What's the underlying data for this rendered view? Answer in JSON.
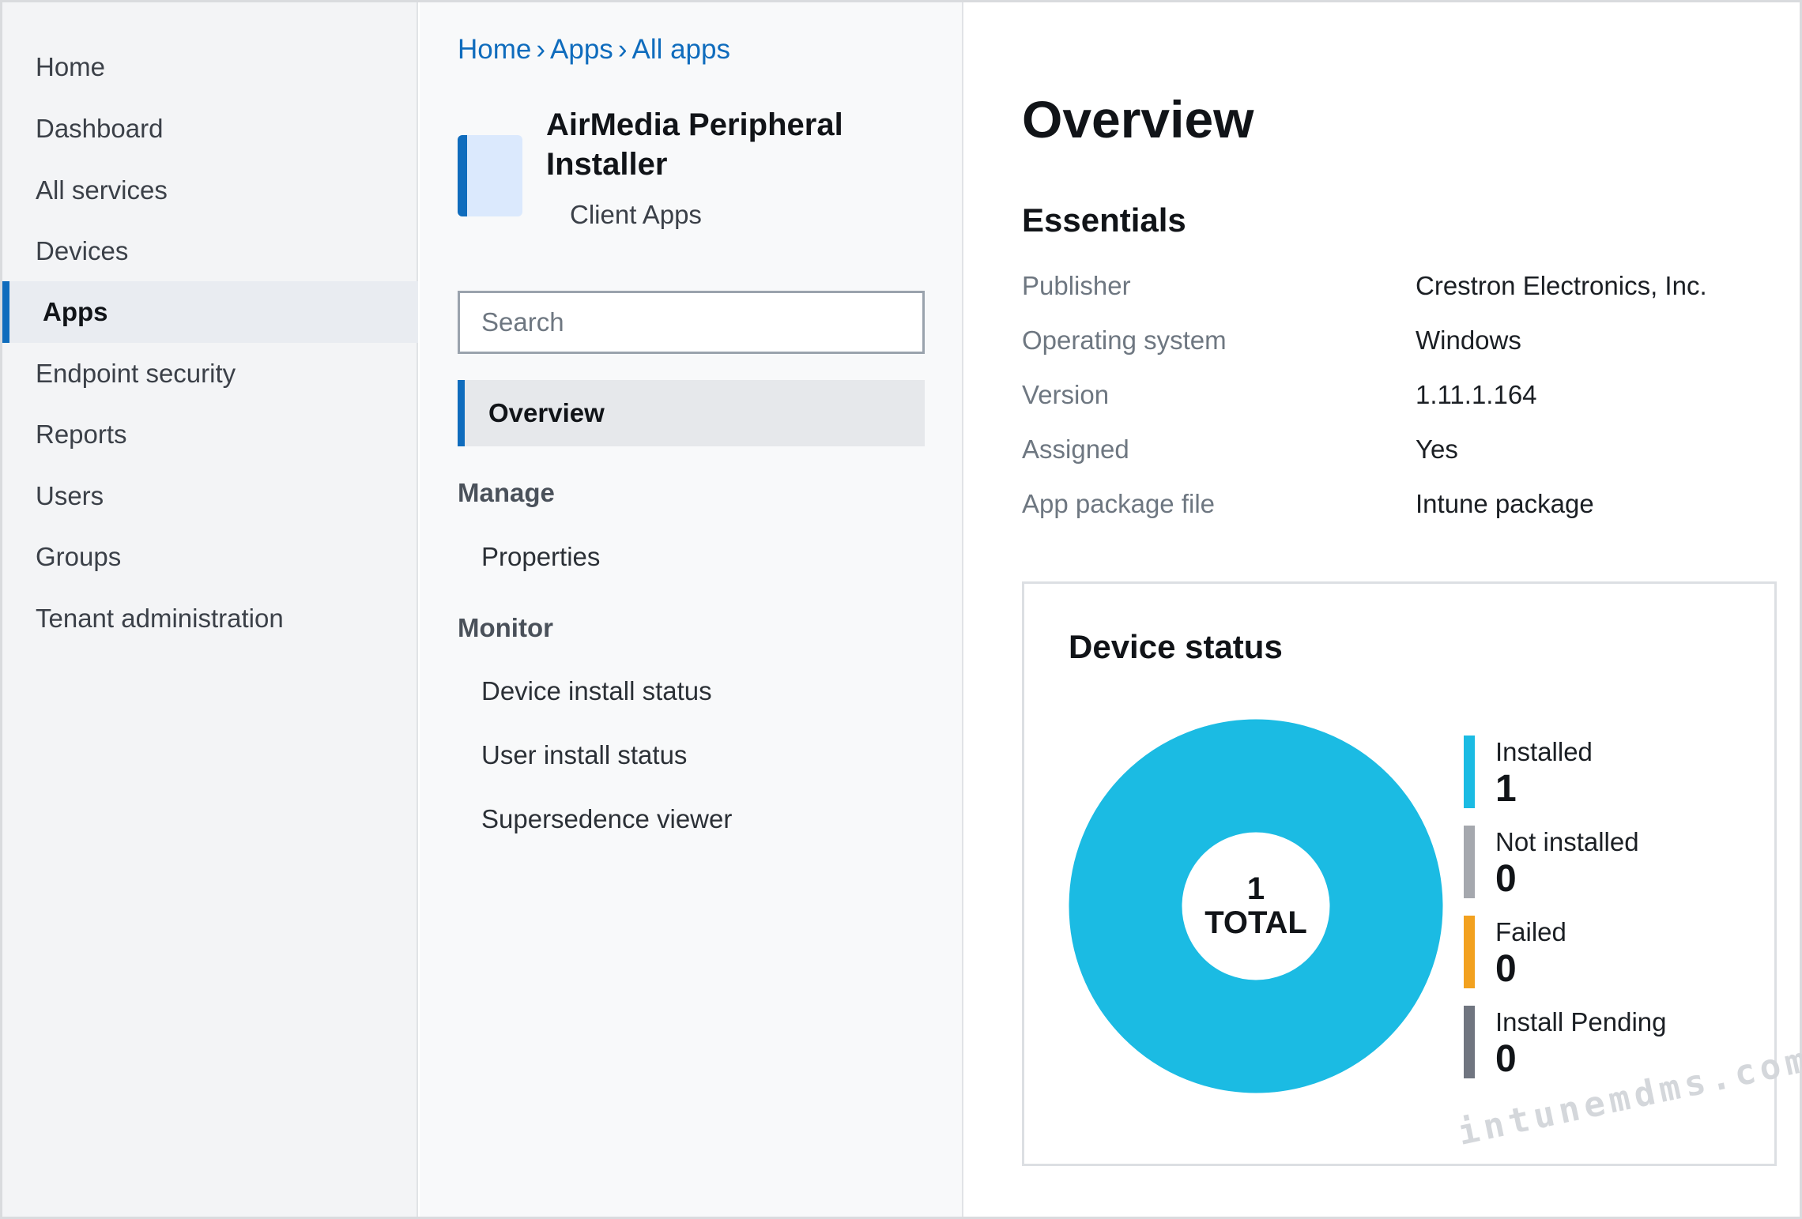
{
  "leftnav": {
    "items": [
      {
        "label": "Home",
        "active": false
      },
      {
        "label": "Dashboard",
        "active": false
      },
      {
        "label": "All services",
        "active": false
      },
      {
        "label": "Devices",
        "active": false
      },
      {
        "label": "Apps",
        "active": true
      },
      {
        "label": "Endpoint security",
        "active": false
      },
      {
        "label": "Reports",
        "active": false
      },
      {
        "label": "Users",
        "active": false
      },
      {
        "label": "Groups",
        "active": false
      },
      {
        "label": "Tenant administration",
        "active": false
      }
    ]
  },
  "breadcrumb": {
    "items": [
      "Home",
      "Apps",
      "All apps"
    ],
    "separator": "›"
  },
  "app": {
    "title": "AirMedia Peripheral Installer",
    "subtitle": "Client Apps"
  },
  "search": {
    "placeholder": "Search"
  },
  "midnav": {
    "overview": "Overview",
    "manage_label": "Manage",
    "manage_items": [
      "Properties"
    ],
    "monitor_label": "Monitor",
    "monitor_items": [
      "Device install status",
      "User install status",
      "Supersedence viewer"
    ]
  },
  "main": {
    "title": "Overview",
    "essentials_title": "Essentials",
    "essentials": [
      {
        "label": "Publisher",
        "value": "Crestron Electronics, Inc."
      },
      {
        "label": "Operating system",
        "value": "Windows"
      },
      {
        "label": "Version",
        "value": "1.11.1.164"
      },
      {
        "label": "Assigned",
        "value": "Yes"
      },
      {
        "label": "App package file",
        "value": "Intune package"
      }
    ]
  },
  "device_status": {
    "title": "Device status",
    "total": "1",
    "total_label": "TOTAL",
    "legend": [
      {
        "label": "Installed",
        "value": "1",
        "color": "#1bbbe3"
      },
      {
        "label": "Not installed",
        "value": "0",
        "color": "#a5a8ae"
      },
      {
        "label": "Failed",
        "value": "0",
        "color": "#f2a11f"
      },
      {
        "label": "Install Pending",
        "value": "0",
        "color": "#707580"
      }
    ]
  },
  "colors": {
    "accent": "#0f6cbd",
    "installed": "#1bbbe3"
  },
  "watermark": "intunemdms.com"
}
